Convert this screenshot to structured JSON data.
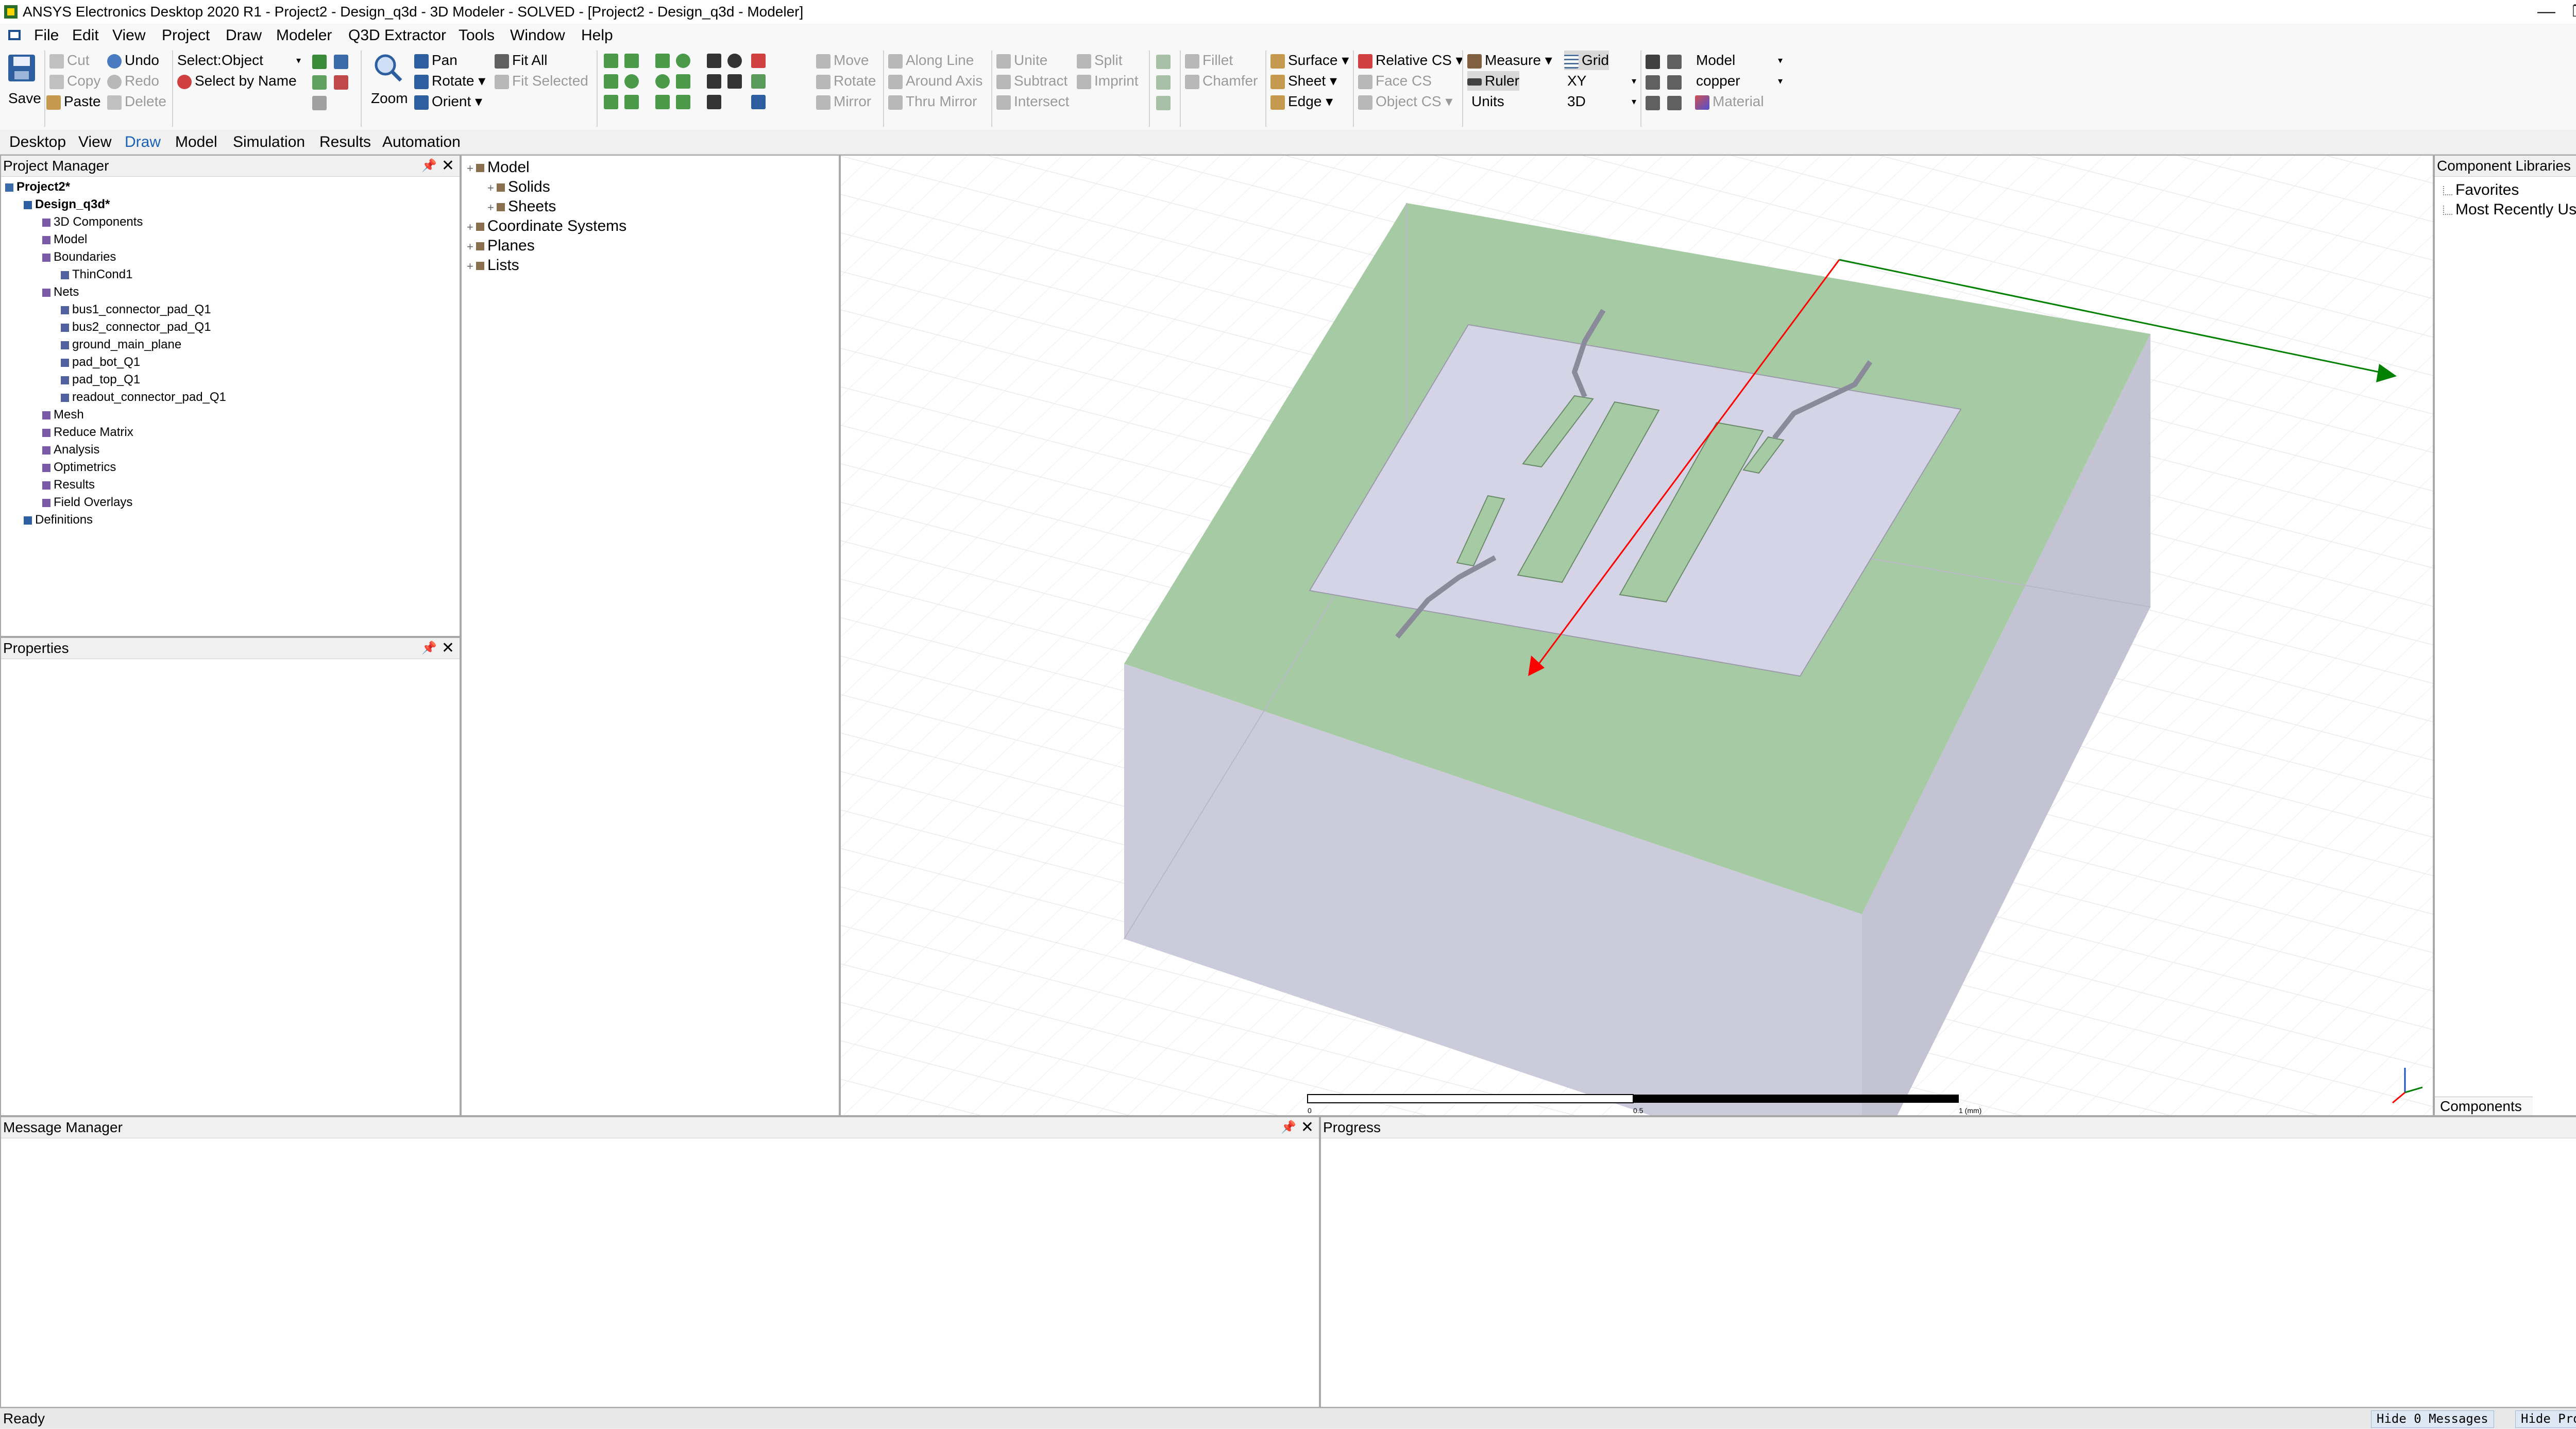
{
  "window": {
    "title": "ANSYS Electronics Desktop 2020 R1 - Project2 - Design_q3d - 3D Modeler - SOLVED - [Project2 - Design_q3d - Modeler]",
    "minimize": "—",
    "restore": "❐",
    "close": "✕"
  },
  "menu": [
    "File",
    "Edit",
    "View",
    "Project",
    "Draw",
    "Modeler",
    "Q3D Extractor",
    "Tools",
    "Window",
    "Help"
  ],
  "ribbon": {
    "save": "Save",
    "cut": "Cut",
    "copy": "Copy",
    "paste": "Paste",
    "undo": "Undo",
    "redo": "Redo",
    "delete": "Delete",
    "select_label": "Select:",
    "select_value": "Object",
    "select_by_name": "Select by Name",
    "zoom": "Zoom",
    "pan": "Pan",
    "rotate": "Rotate",
    "orient": "Orient",
    "fit_all": "Fit All",
    "fit_selected": "Fit Selected",
    "move": "Move",
    "rotate2": "Rotate",
    "mirror": "Mirror",
    "along_line": "Along Line",
    "around_axis": "Around Axis",
    "thru_mirror": "Thru Mirror",
    "unite": "Unite",
    "subtract": "Subtract",
    "intersect": "Intersect",
    "split": "Split",
    "imprint": "Imprint",
    "fillet": "Fillet",
    "chamfer": "Chamfer",
    "surface": "Surface",
    "sheet": "Sheet",
    "edge": "Edge",
    "relative_cs": "Relative CS",
    "face_cs": "Face CS",
    "object_cs": "Object CS",
    "measure": "Measure",
    "ruler": "Ruler",
    "units": "Units",
    "grid": "Grid",
    "plane_value": "XY",
    "view_value": "3D",
    "model_value": "Model",
    "material_value": "copper",
    "material": "Material"
  },
  "tabs": [
    "Desktop",
    "View",
    "Draw",
    "Model",
    "Simulation",
    "Results",
    "Automation"
  ],
  "active_tab": "Draw",
  "project_manager": {
    "title": "Project Manager",
    "items": [
      {
        "label": "Project2*",
        "depth": 0,
        "bold": true
      },
      {
        "label": "Design_q3d*",
        "depth": 1,
        "bold": true
      },
      {
        "label": "3D Components",
        "depth": 2
      },
      {
        "label": "Model",
        "depth": 2
      },
      {
        "label": "Boundaries",
        "depth": 2
      },
      {
        "label": "ThinCond1",
        "depth": 3
      },
      {
        "label": "Nets",
        "depth": 2
      },
      {
        "label": "bus1_connector_pad_Q1",
        "depth": 3
      },
      {
        "label": "bus2_connector_pad_Q1",
        "depth": 3
      },
      {
        "label": "ground_main_plane",
        "depth": 3
      },
      {
        "label": "pad_bot_Q1",
        "depth": 3
      },
      {
        "label": "pad_top_Q1",
        "depth": 3
      },
      {
        "label": "readout_connector_pad_Q1",
        "depth": 3
      },
      {
        "label": "Mesh",
        "depth": 2
      },
      {
        "label": "Reduce Matrix",
        "depth": 2
      },
      {
        "label": "Analysis",
        "depth": 2
      },
      {
        "label": "Optimetrics",
        "depth": 2
      },
      {
        "label": "Results",
        "depth": 2
      },
      {
        "label": "Field Overlays",
        "depth": 2
      },
      {
        "label": "Definitions",
        "depth": 1
      }
    ]
  },
  "model_tree": [
    {
      "label": "Model",
      "depth": 0
    },
    {
      "label": "Solids",
      "depth": 1
    },
    {
      "label": "Sheets",
      "depth": 1
    },
    {
      "label": "Coordinate Systems",
      "depth": 0
    },
    {
      "label": "Planes",
      "depth": 0
    },
    {
      "label": "Lists",
      "depth": 0
    }
  ],
  "properties": {
    "title": "Properties"
  },
  "component_libraries": {
    "title": "Component Libraries",
    "items": [
      "Favorites",
      "Most Recently Used"
    ],
    "tab": "Components"
  },
  "viewport": {
    "scale_labels": [
      "0",
      "0.5",
      "1 (mm)"
    ],
    "colors": {
      "box_top": "#a6cba4",
      "box_side": "#c3c3d4",
      "box_front": "#cbcbdc",
      "opening": "#d4d4e6",
      "axis_x": "#ff0000",
      "axis_y": "#008000"
    }
  },
  "message_manager": {
    "title": "Message Manager"
  },
  "progress": {
    "title": "Progress"
  },
  "status": {
    "text": "Ready",
    "hide_messages": "Hide 0 Messages",
    "hide_progress": "Hide Progress"
  }
}
